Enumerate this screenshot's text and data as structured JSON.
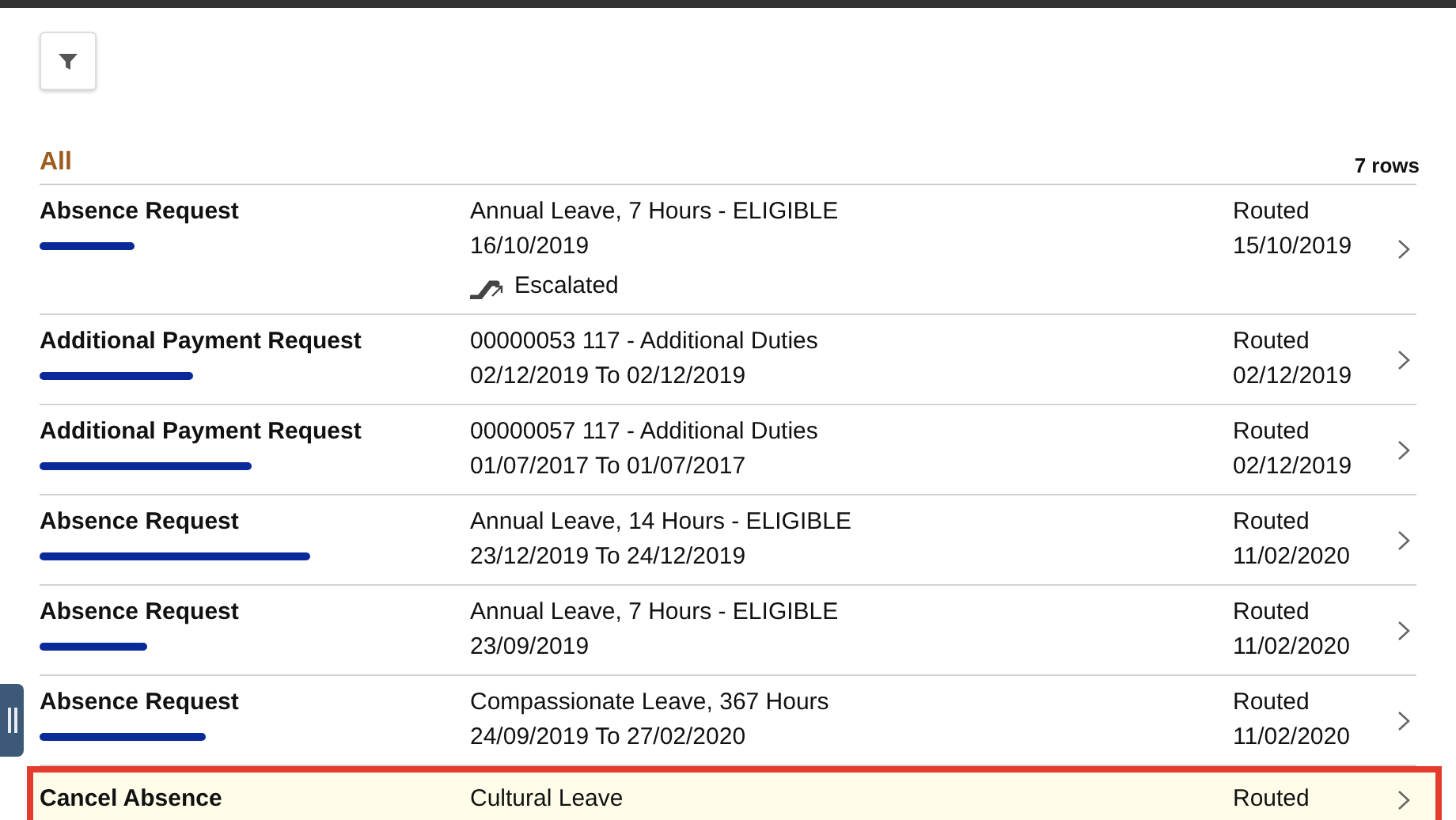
{
  "list": {
    "heading": "All",
    "count": "7 rows",
    "rows": [
      {
        "title": "Absence Request",
        "redacted": true,
        "details": [
          "Annual Leave, 7 Hours - ELIGIBLE",
          "16/10/2019"
        ],
        "escalation": "Escalated",
        "status": "Routed",
        "date": "15/10/2019",
        "selected": false
      },
      {
        "title": "Additional Payment Request",
        "redacted": true,
        "details": [
          "00000053  117 - Additional Duties",
          "02/12/2019 To 02/12/2019"
        ],
        "status": "Routed",
        "date": "02/12/2019",
        "selected": false
      },
      {
        "title": "Additional Payment Request",
        "redacted": true,
        "details": [
          "00000057  117 - Additional Duties",
          "01/07/2017 To 01/07/2017"
        ],
        "status": "Routed",
        "date": "02/12/2019",
        "selected": false
      },
      {
        "title": "Absence Request",
        "redacted": true,
        "details": [
          "Annual Leave, 14 Hours - ELIGIBLE",
          "23/12/2019 To 24/12/2019"
        ],
        "status": "Routed",
        "date": "11/02/2020",
        "selected": false
      },
      {
        "title": "Absence Request",
        "redacted": true,
        "details": [
          "Annual Leave, 7 Hours - ELIGIBLE",
          "23/09/2019"
        ],
        "status": "Routed",
        "date": "11/02/2020",
        "selected": false
      },
      {
        "title": "Absence Request",
        "redacted": true,
        "details": [
          "Compassionate Leave, 367 Hours",
          "24/09/2019 To 27/02/2020"
        ],
        "status": "Routed",
        "date": "11/02/2020",
        "selected": false
      },
      {
        "title": "Cancel Absence",
        "redacted": false,
        "details": [
          "Cultural Leave"
        ],
        "status": "Routed",
        "selected": true
      }
    ]
  }
}
